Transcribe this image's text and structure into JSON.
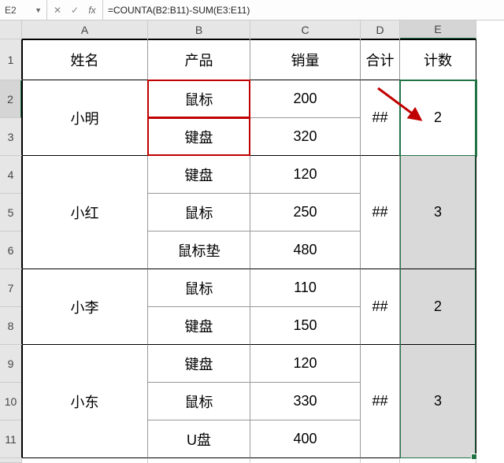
{
  "formula_bar": {
    "name_box": "E2",
    "cancel_tooltip": "Cancel",
    "enter_tooltip": "Enter",
    "fx_tooltip": "Insert Function",
    "formula": "=COUNTA(B2:B11)-SUM(E3:E11)"
  },
  "columns": [
    "A",
    "B",
    "C",
    "D",
    "E"
  ],
  "headers": {
    "A": "姓名",
    "B": "产品",
    "C": "销量",
    "D": "合计",
    "E": "计数"
  },
  "groups": [
    {
      "name": "小明",
      "d": "##",
      "e": "2",
      "shade": false,
      "rows": [
        {
          "b": "鼠标",
          "c": "200"
        },
        {
          "b": "键盘",
          "c": "320"
        }
      ]
    },
    {
      "name": "小红",
      "d": "##",
      "e": "3",
      "shade": true,
      "rows": [
        {
          "b": "键盘",
          "c": "120"
        },
        {
          "b": "鼠标",
          "c": "250"
        },
        {
          "b": "鼠标垫",
          "c": "480"
        }
      ]
    },
    {
      "name": "小李",
      "d": "##",
      "e": "2",
      "shade": true,
      "rows": [
        {
          "b": "鼠标",
          "c": "110"
        },
        {
          "b": "键盘",
          "c": "150"
        }
      ]
    },
    {
      "name": "小东",
      "d": "##",
      "e": "3",
      "shade": true,
      "rows": [
        {
          "b": "键盘",
          "c": "120"
        },
        {
          "b": "鼠标",
          "c": "330"
        },
        {
          "b": "U盘",
          "c": "400"
        }
      ]
    }
  ],
  "row_count_visible": 11
}
